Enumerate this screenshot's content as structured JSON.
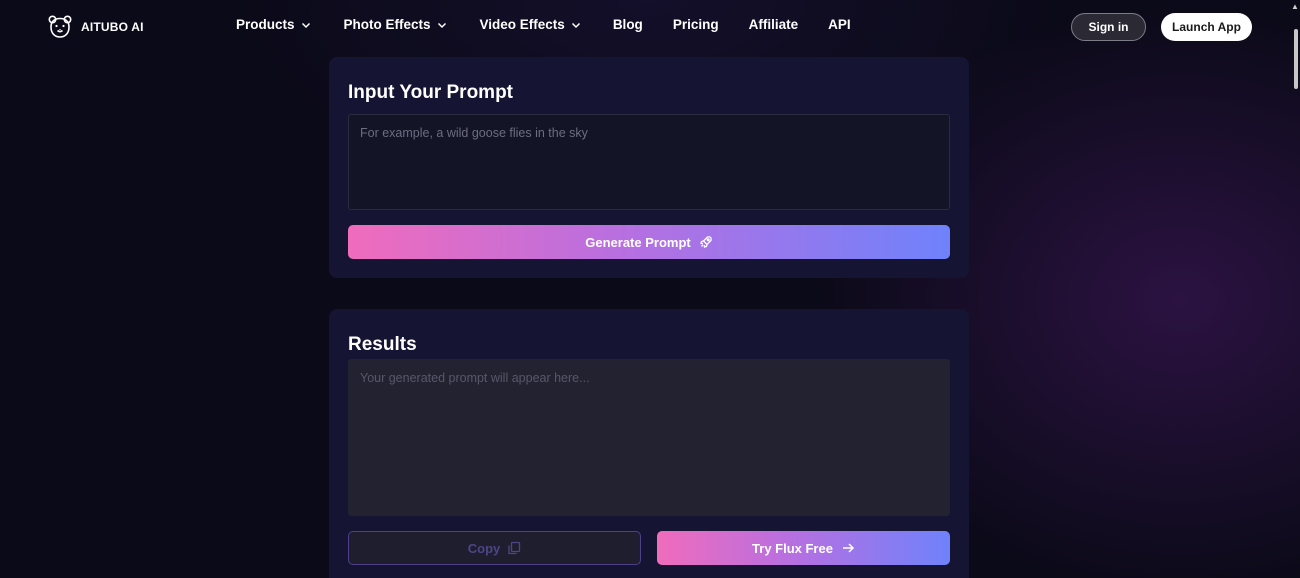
{
  "brand": {
    "name": "AITUBO AI",
    "logo_icon": "bear-icon"
  },
  "nav": {
    "items": [
      {
        "label": "Products",
        "has_dropdown": true
      },
      {
        "label": "Photo Effects",
        "has_dropdown": true
      },
      {
        "label": "Video Effects",
        "has_dropdown": true
      },
      {
        "label": "Blog",
        "has_dropdown": false
      },
      {
        "label": "Pricing",
        "has_dropdown": false
      },
      {
        "label": "Affiliate",
        "has_dropdown": false
      },
      {
        "label": "API",
        "has_dropdown": false
      }
    ],
    "signin_label": "Sign in",
    "launch_label": "Launch App"
  },
  "input_card": {
    "title": "Input Your Prompt",
    "placeholder": "For example, a wild goose flies in the sky",
    "generate_label": "Generate Prompt",
    "generate_icon": "rocket-icon"
  },
  "results_card": {
    "title": "Results",
    "placeholder": "Your generated prompt will appear here...",
    "copy_label": "Copy",
    "copy_icon": "copy-icon",
    "try_label": "Try Flux Free",
    "try_icon": "arrow-right-icon"
  },
  "colors": {
    "background": "#0b0a18",
    "card": "#151433",
    "gradient_start": "#f06cbc",
    "gradient_end": "#6f82fb"
  }
}
